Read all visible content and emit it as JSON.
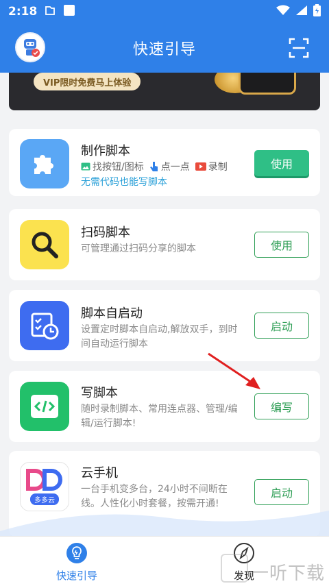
{
  "status_bar": {
    "time": "2:18"
  },
  "app_bar": {
    "title": "快速引导"
  },
  "banner": {
    "promo": "VIP限时免费马上体验"
  },
  "cards": [
    {
      "name": "制作脚本",
      "features": [
        "找按钮/图标",
        "点一点",
        "录制"
      ],
      "subtitle": "无需代码也能写脚本",
      "button": "使用"
    },
    {
      "name": "扫码脚本",
      "desc": "可管理通过扫码分享的脚本",
      "button": "使用"
    },
    {
      "name": "脚本自启动",
      "desc": "设置定时脚本自启动,解放双手，到时间自动运行脚本",
      "button": "启动"
    },
    {
      "name": "写脚本",
      "desc": "随时录制脚本、常用连点器、管理/编辑/运行脚本!",
      "button": "编写"
    },
    {
      "name": "云手机",
      "desc": "一台手机变多台，24小时不间断在线。人性化小时套餐，按需开通!",
      "icon_label": "多多云",
      "button": "启动"
    }
  ],
  "tab_bar": {
    "tabs": [
      {
        "label": "快速引导",
        "active": true
      },
      {
        "label": "发现",
        "active": false
      }
    ]
  },
  "watermark": "一听下载",
  "colors": {
    "primary": "#2f80e8",
    "green": "#2e9e55",
    "link": "#2aa0d8"
  }
}
